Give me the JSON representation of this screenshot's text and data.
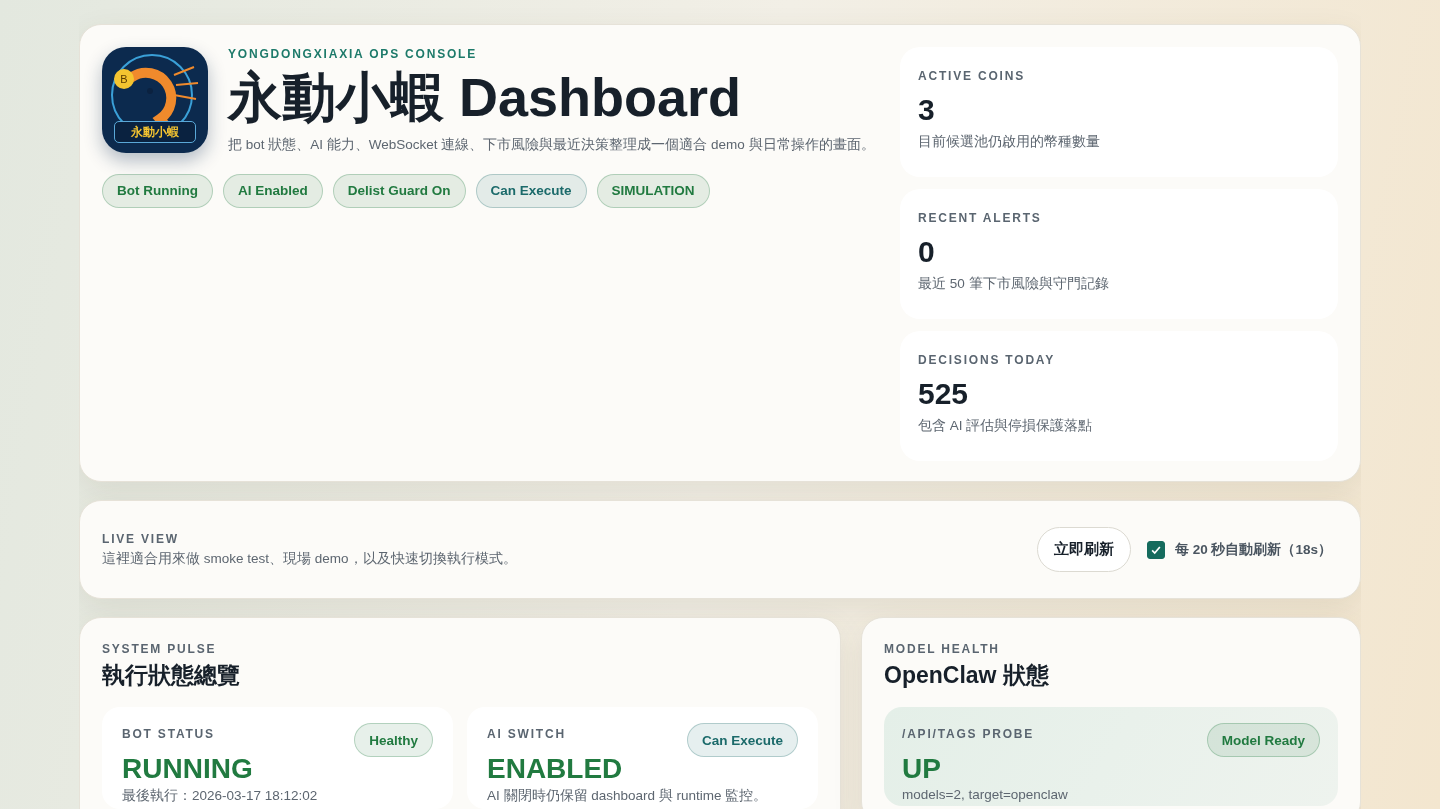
{
  "hero": {
    "logo": {
      "badge": "B",
      "label": "永動小蝦"
    },
    "eyebrow": "YONGDONGXIAXIA OPS CONSOLE",
    "title": "永動小蝦 Dashboard",
    "subtitle": "把 bot 狀態、AI 能力、WebSocket 連線、下市風險與最近決策整理成一個適合 demo 與日常操作的畫面。",
    "chips": [
      {
        "label": "Bot Running",
        "color": "#217a40"
      },
      {
        "label": "AI Enabled",
        "color": "#217a40"
      },
      {
        "label": "Delist Guard On",
        "color": "#217a40"
      },
      {
        "label": "Can Execute",
        "color": "#1b6a6a"
      },
      {
        "label": "SIMULATION",
        "color": "#217a40"
      }
    ]
  },
  "stats": [
    {
      "label": "ACTIVE COINS",
      "value": "3",
      "note": "目前候選池仍啟用的幣種數量"
    },
    {
      "label": "RECENT ALERTS",
      "value": "0",
      "note": "最近 50 筆下市風險與守門記錄"
    },
    {
      "label": "DECISIONS TODAY",
      "value": "525",
      "note": "包含 AI 評估與停損保護落點"
    }
  ],
  "live": {
    "eyebrow": "LIVE VIEW",
    "text": "這裡適合用來做 smoke test、現場 demo，以及快速切換執行模式。",
    "refresh_button": "立即刷新",
    "auto_refresh": {
      "label": "每 20 秒自動刷新（18s）",
      "checked": true
    }
  },
  "pulse": {
    "eyebrow": "SYSTEM PULSE",
    "title": "執行狀態總覽",
    "cards": [
      {
        "label": "BOT STATUS",
        "badge": {
          "label": "Healthy",
          "color": "#217a40"
        },
        "value": "RUNNING",
        "note": "最後執行：2026-03-17 18:12:02"
      },
      {
        "label": "AI SWITCH",
        "badge": {
          "label": "Can Execute",
          "color": "#1b6a6a"
        },
        "value": "ENABLED",
        "note": "AI 關閉時仍保留 dashboard 與 runtime 監控。"
      }
    ]
  },
  "model": {
    "eyebrow": "MODEL HEALTH",
    "title": "OpenClaw 狀態",
    "probe": {
      "label": "/API/TAGS PROBE",
      "badge": {
        "label": "Model Ready",
        "color": "#217a40"
      },
      "value": "UP",
      "note": "models=2, target=openclaw"
    }
  }
}
